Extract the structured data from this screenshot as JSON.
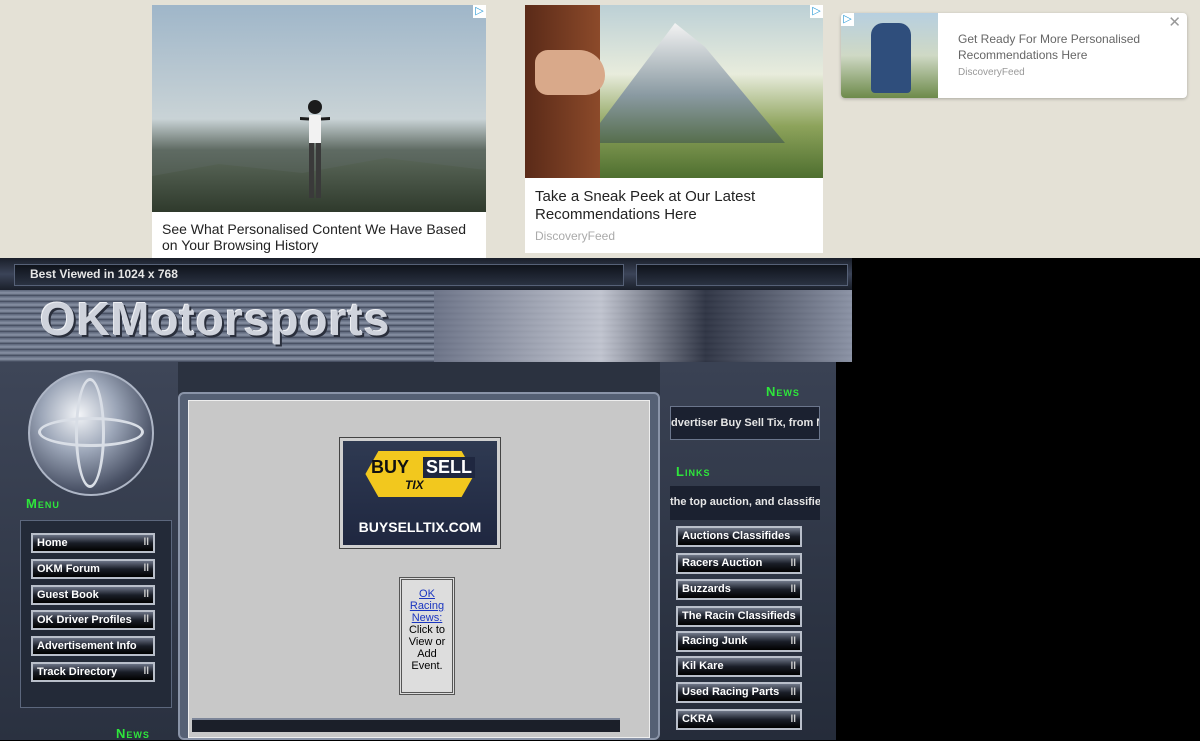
{
  "ads": [
    {
      "text": "See What Personalised Content We Have Based on Your Browsing History",
      "choice_icon": "ad-choices-icon"
    },
    {
      "text": "Take a Sneak Peek at Our Latest Recommendations Here",
      "source": "DiscoveryFeed",
      "choice_icon": "ad-choices-icon"
    },
    {
      "text": "Get Ready For More Personalised Recommendations Here",
      "source": "DiscoveryFeed",
      "close": "✕",
      "choice_icon": "ad-choices-icon"
    }
  ],
  "header": {
    "best_viewed": "Best Viewed in 1024 x 768",
    "logo": "OKMotorsports"
  },
  "menu": {
    "title": "Menu",
    "items": [
      "Home",
      "OKM Forum",
      "Guest Book",
      "OK Driver Profiles",
      "Advertisement Info",
      "Track Directory"
    ],
    "news_title": "News"
  },
  "center": {
    "buyselltix": {
      "buy": "BUY",
      "sell": "SELL",
      "tix": "TIX",
      "url": "BUYSELLTIX.COM"
    },
    "news_link": "OK Racing News:",
    "news_text": "Click to View or Add Event."
  },
  "right": {
    "news_title": "News",
    "news_ticker": "dvertiser Buy Sell Tix, from NF",
    "links_title": "Links",
    "links_ticker": "the top auction, and classified",
    "links": [
      "Auctions Classifides",
      "Racers Auction",
      "Buzzards",
      "The Racin Classifieds",
      "Racing Junk",
      "Kil Kare",
      "Used Racing Parts",
      "CKRA"
    ]
  },
  "colors": {
    "accent_green": "#2ee63b",
    "ad_background": "#e4e1d6"
  }
}
